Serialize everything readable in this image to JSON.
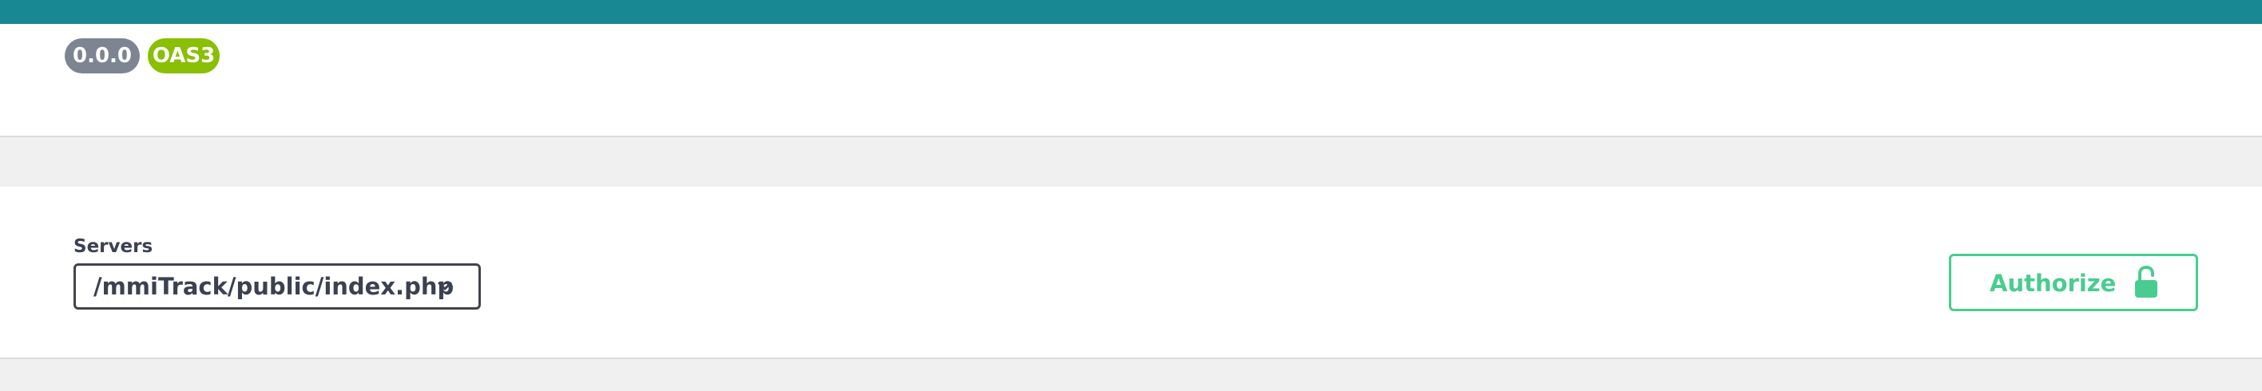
{
  "info": {
    "version_badge": "0.0.0",
    "spec_badge": "OAS3"
  },
  "servers": {
    "label": "Servers",
    "selected": "/mmiTrack/public/index.php"
  },
  "authorize": {
    "label": "Authorize",
    "icon": "unlock-icon"
  },
  "colors": {
    "topbar": "#188892",
    "version_badge": "#7d8592",
    "spec_badge": "#89bf04",
    "authorize": "#49cc90",
    "text": "#3b4151"
  }
}
